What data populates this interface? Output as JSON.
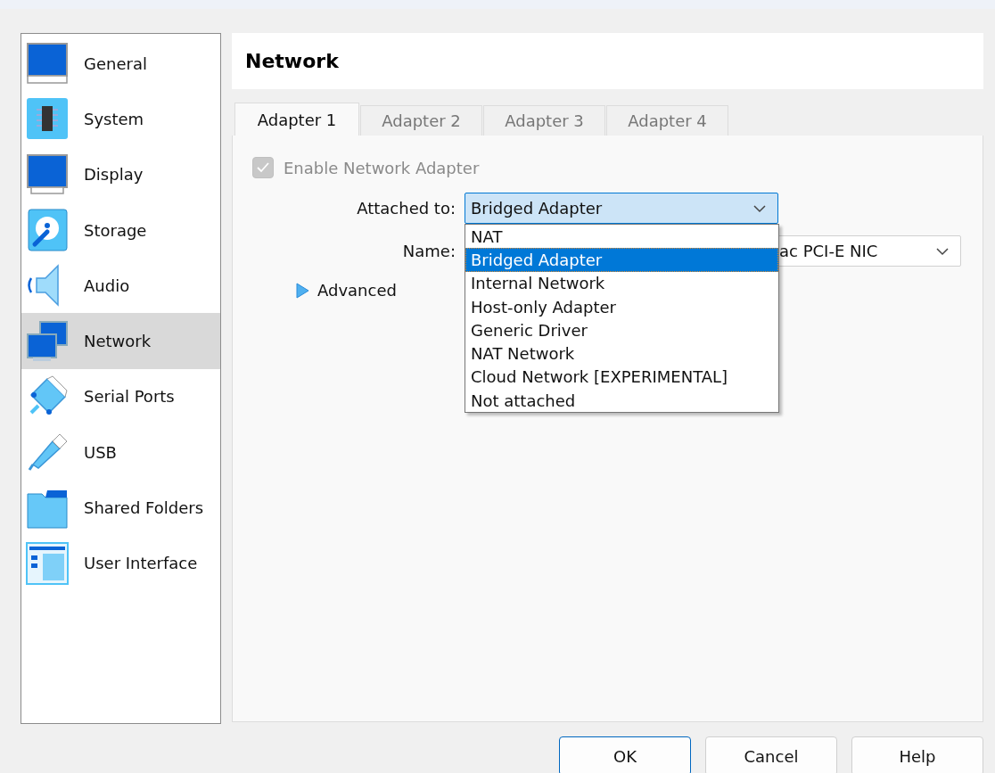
{
  "sidebar": {
    "items": [
      {
        "label": "General",
        "selected": false
      },
      {
        "label": "System",
        "selected": false
      },
      {
        "label": "Display",
        "selected": false
      },
      {
        "label": "Storage",
        "selected": false
      },
      {
        "label": "Audio",
        "selected": false
      },
      {
        "label": "Network",
        "selected": true
      },
      {
        "label": "Serial Ports",
        "selected": false
      },
      {
        "label": "USB",
        "selected": false
      },
      {
        "label": "Shared Folders",
        "selected": false
      },
      {
        "label": "User Interface",
        "selected": false
      }
    ]
  },
  "page_title": "Network",
  "tabs": [
    {
      "label": "Adapter 1",
      "selected": true
    },
    {
      "label": "Adapter 2",
      "selected": false
    },
    {
      "label": "Adapter 3",
      "selected": false
    },
    {
      "label": "Adapter 4",
      "selected": false
    }
  ],
  "enable_adapter": {
    "label": "Enable Network Adapter",
    "checked": true,
    "disabled": true
  },
  "attached_to": {
    "label": "Attached to:",
    "value": "Bridged Adapter",
    "expanded": true,
    "options": [
      {
        "label": "NAT",
        "selected": false
      },
      {
        "label": "Bridged Adapter",
        "selected": true
      },
      {
        "label": "Internal Network",
        "selected": false
      },
      {
        "label": "Host-only Adapter",
        "selected": false
      },
      {
        "label": "Generic Driver",
        "selected": false
      },
      {
        "label": "NAT Network",
        "selected": false
      },
      {
        "label": "Cloud Network [EXPERIMENTAL]",
        "selected": false
      },
      {
        "label": "Not attached",
        "selected": false
      }
    ]
  },
  "name": {
    "label": "Name:",
    "value": "ac PCI-E NIC"
  },
  "advanced": {
    "label": "Advanced",
    "expanded": false
  },
  "buttons": [
    {
      "label": "OK",
      "default": true
    },
    {
      "label": "Cancel",
      "default": false
    },
    {
      "label": "Help",
      "default": false
    }
  ]
}
